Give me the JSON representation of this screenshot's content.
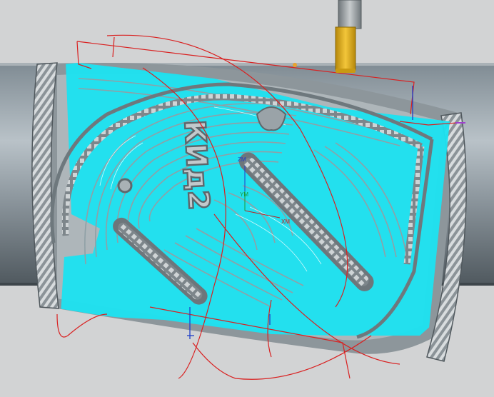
{
  "viewport": {
    "background": "#d2d3d4",
    "tool_color": "#e8b21a",
    "toolpath_color": "#1de2f0",
    "link_path_color": "#d92020",
    "engraving_text": "КИд2",
    "axes": {
      "x": "XM",
      "y": "YM",
      "z": "ZM"
    }
  }
}
